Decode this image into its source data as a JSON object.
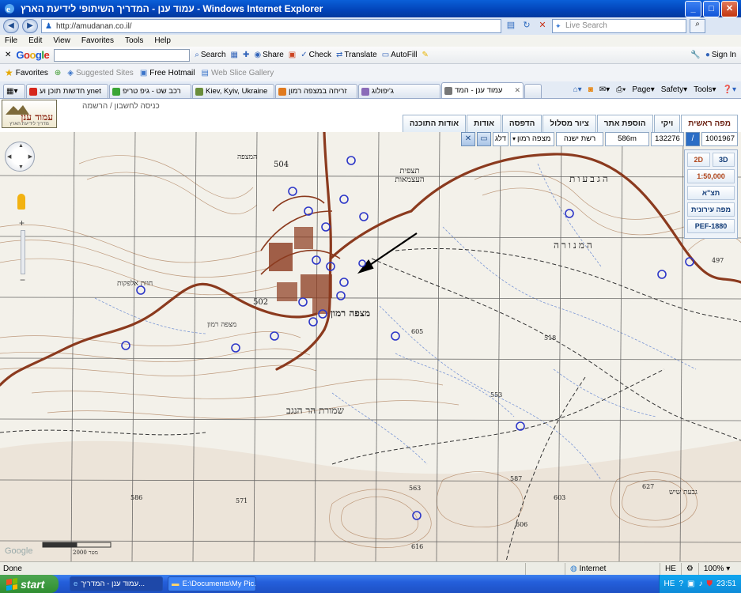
{
  "window": {
    "title": "עמוד ענן - המדריך השיתופי לידיעת הארץ - Windows Internet Explorer"
  },
  "address": {
    "url": "http://amudanan.co.il/",
    "search_placeholder": "Live Search"
  },
  "menu": [
    "File",
    "Edit",
    "View",
    "Favorites",
    "Tools",
    "Help"
  ],
  "google_toolbar": {
    "logo": "Google",
    "search": "Search",
    "share": "Share",
    "check": "Check",
    "translate": "Translate",
    "autofill": "AutoFill",
    "signin": "Sign In"
  },
  "favorites": {
    "label": "Favorites",
    "items": [
      "Suggested Sites",
      "Free Hotmail",
      "Web Slice Gallery"
    ]
  },
  "tabs": [
    {
      "label": "חדשות תוכן וע ynet",
      "color": "#d6261c"
    },
    {
      "label": "רכב שט - גיפ טריפ",
      "color": "#3aa535"
    },
    {
      "label": "Kiev, Kyiv, Ukraine",
      "color": "#6a8d3a"
    },
    {
      "label": "זריחה במצפה רמון",
      "color": "#e07a1f"
    },
    {
      "label": "ג'יפולוג",
      "color": "#8a6bb8"
    },
    {
      "label": "עמוד ענן - המד",
      "color": "#777777"
    }
  ],
  "command_bar": {
    "page": "Page",
    "safety": "Safety",
    "tools": "Tools"
  },
  "site": {
    "logo_name": "עמוד ענן",
    "logo_sub": "מדריך לידיעת הארץ",
    "login": "כניסה לחשבון / הרשמה",
    "nav": [
      "מפה ראשית",
      "ויקי",
      "הוספת אתר",
      "ציור מסלול",
      "הדפסה",
      "אודות",
      "אודות התוכנה"
    ]
  },
  "map_panel": {
    "coord_x": "1001967",
    "coord_y": "132276",
    "elevation": "586m",
    "layer": "רשת ישנה",
    "place": "מצפה רמון",
    "go": "דלג",
    "btn_3d": "3D",
    "btn_2d": "2D",
    "scale": "1:50,000",
    "tsa": "תצ\"א",
    "city_map": "מפה עירונית",
    "pef": "PEF-1880"
  },
  "map_labels": {
    "mitzpe_ramon_big": "מצפה רמון",
    "mitzpe_ramon_small": "מצפה רמון",
    "har_hanegev": "שמורת הר הנגב",
    "hamanora": "המנורה",
    "hagvaot": "הגבעות",
    "hazot": "חוות אלפקות",
    "hamitzpe": "המצפה",
    "givat": "גבעת שיש",
    "tatzpit": "תצפית העצמאות",
    "heights": [
      "504",
      "502",
      "586",
      "571",
      "563",
      "587",
      "603",
      "627",
      "616",
      "606",
      "553",
      "518",
      "497",
      "605"
    ],
    "scale_bar": "2000 מטר",
    "google": "Google"
  },
  "status": {
    "left": "Done",
    "zone": "Internet",
    "lang": "HE",
    "zoom": "100%"
  },
  "taskbar": {
    "start": "start",
    "items": [
      "עמוד ענן - המדריך...",
      "E:\\Documents\\My Pic..."
    ],
    "clock": "23:51",
    "lang": "HE"
  },
  "colors": {
    "road": "#8b3a1e",
    "marker": "#2c36c8",
    "grid": "#4a4a4a",
    "contour": "#b58b6a",
    "water": "#5b7fd0"
  }
}
